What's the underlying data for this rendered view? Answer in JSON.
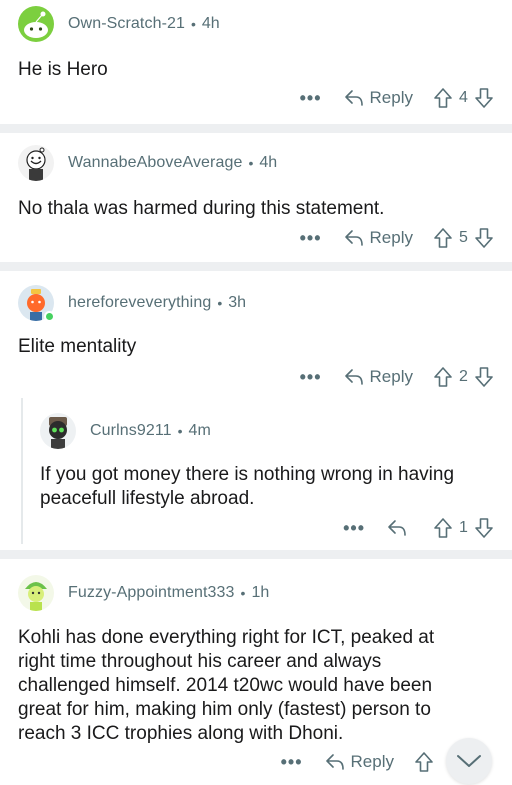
{
  "comments": [
    {
      "username": "Own-Scratch-21",
      "time": "4h",
      "body": "He is Hero",
      "reply_label": "Reply",
      "votes": "4",
      "avatar": "green-snoo-avatar"
    },
    {
      "username": "WannabeAboveAverage",
      "time": "4h",
      "body": "No thala was harmed during this statement.",
      "reply_label": "Reply",
      "votes": "5",
      "avatar": "white-snoo-avatar"
    },
    {
      "username": "hereforeveverything",
      "time": "3h",
      "body": "Elite mentality",
      "reply_label": "Reply",
      "votes": "2",
      "avatar": "orange-snoo-avatar",
      "online": true
    },
    {
      "username": "Curlns9211",
      "time": "4m",
      "body_lines": [
        "If you got money there is nothing wrong in having",
        "peacefull lifestyle abroad."
      ],
      "votes": "1",
      "avatar": "dark-hooded-snoo-avatar"
    },
    {
      "username": "Fuzzy-Appointment333",
      "time": "1h",
      "body_lines": [
        "Kohli has done everything right for ICT, peaked at",
        "right time throughout his career and always",
        "challenged himself. 2014 t20wc  would have been",
        "great for him, making him only (fastest) person to",
        "reach 3 ICC trophies  along with Dhoni."
      ],
      "reply_label": "Reply",
      "avatar": "lime-snoo-avatar"
    }
  ],
  "meta_separator": "•",
  "more_label": "•••",
  "colors": {
    "text": "#1a1a1b",
    "meta": "#576f76",
    "separator": "#edeff1",
    "online": "#46d160"
  }
}
